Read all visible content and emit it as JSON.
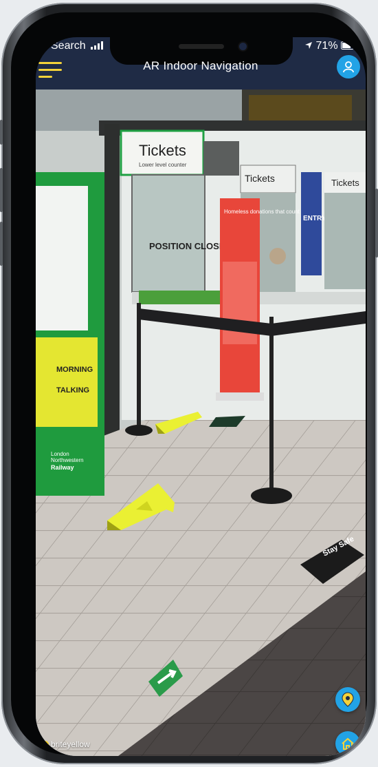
{
  "status_bar": {
    "carrier": "Search",
    "battery": "71%"
  },
  "app": {
    "title": "AR Indoor Navigation"
  },
  "scene": {
    "sign_tickets_main": "Tickets",
    "sign_tickets_sub": "Lower level counter",
    "sign_tickets_2": "Tickets",
    "sign_tickets_3": "Tickets",
    "window_notice": "POSITION CLOSED",
    "poster_entry": "ENTRY",
    "kiosk_text": "Homeless donations that count",
    "banner_text_1": "MORNING",
    "banner_text_2": "TALKING",
    "railway_line1": "London",
    "railway_line2": "Northwestern",
    "railway_line3": "Railway",
    "floor_sticker": "Stay Safe"
  },
  "footer": {
    "brand": "briteyellow"
  },
  "colors": {
    "accent": "#22a3e6",
    "navbar": "#1f2b45",
    "ar_arrow": "#e9ef2f",
    "menu": "#f3d23a"
  },
  "icons": {
    "menu": "menu-icon",
    "profile": "user-icon",
    "location": "location-pin-icon",
    "home": "home-icon"
  }
}
